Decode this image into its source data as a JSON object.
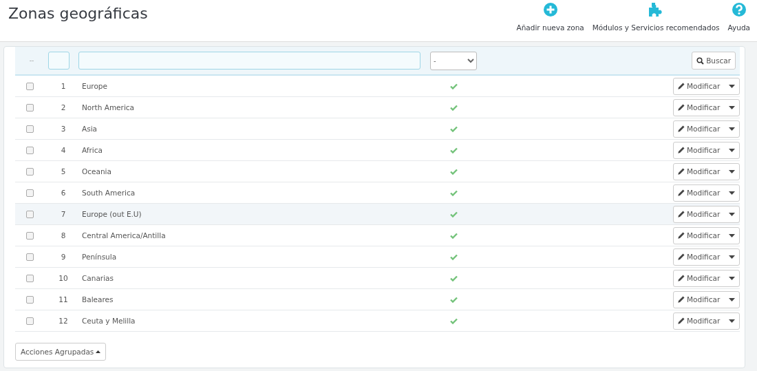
{
  "page": {
    "title": "Zonas geográficas"
  },
  "toolbar": [
    {
      "kind": "add",
      "label": "Añadir nueva zona"
    },
    {
      "kind": "modules",
      "label": "Módulos y Servicios recomendados"
    },
    {
      "kind": "help",
      "label": "Ayuda"
    }
  ],
  "filters": {
    "bulk_marker": "--",
    "active_select": "-",
    "search_button": "Buscar"
  },
  "rows": [
    {
      "id": "1",
      "name": "Europe",
      "active": true,
      "checked": false,
      "selected": false,
      "action": "Modificar"
    },
    {
      "id": "2",
      "name": "North America",
      "active": true,
      "checked": false,
      "selected": false,
      "action": "Modificar"
    },
    {
      "id": "3",
      "name": "Asia",
      "active": true,
      "checked": false,
      "selected": false,
      "action": "Modificar"
    },
    {
      "id": "4",
      "name": "Africa",
      "active": true,
      "checked": false,
      "selected": false,
      "action": "Modificar"
    },
    {
      "id": "5",
      "name": "Oceania",
      "active": true,
      "checked": false,
      "selected": false,
      "action": "Modificar"
    },
    {
      "id": "6",
      "name": "South America",
      "active": true,
      "checked": false,
      "selected": false,
      "action": "Modificar"
    },
    {
      "id": "7",
      "name": "Europe (out E.U)",
      "active": true,
      "checked": false,
      "selected": true,
      "action": "Modificar"
    },
    {
      "id": "8",
      "name": "Central America/Antilla",
      "active": true,
      "checked": false,
      "selected": false,
      "action": "Modificar"
    },
    {
      "id": "9",
      "name": "Península",
      "active": true,
      "checked": false,
      "selected": false,
      "action": "Modificar"
    },
    {
      "id": "10",
      "name": "Canarias",
      "active": true,
      "checked": false,
      "selected": false,
      "action": "Modificar"
    },
    {
      "id": "11",
      "name": "Baleares",
      "active": true,
      "checked": false,
      "selected": false,
      "action": "Modificar"
    },
    {
      "id": "12",
      "name": "Ceuta y Melilla",
      "active": true,
      "checked": false,
      "selected": false,
      "action": "Modificar"
    }
  ],
  "bulk_actions": {
    "label": "Acciones Agrupadas"
  }
}
